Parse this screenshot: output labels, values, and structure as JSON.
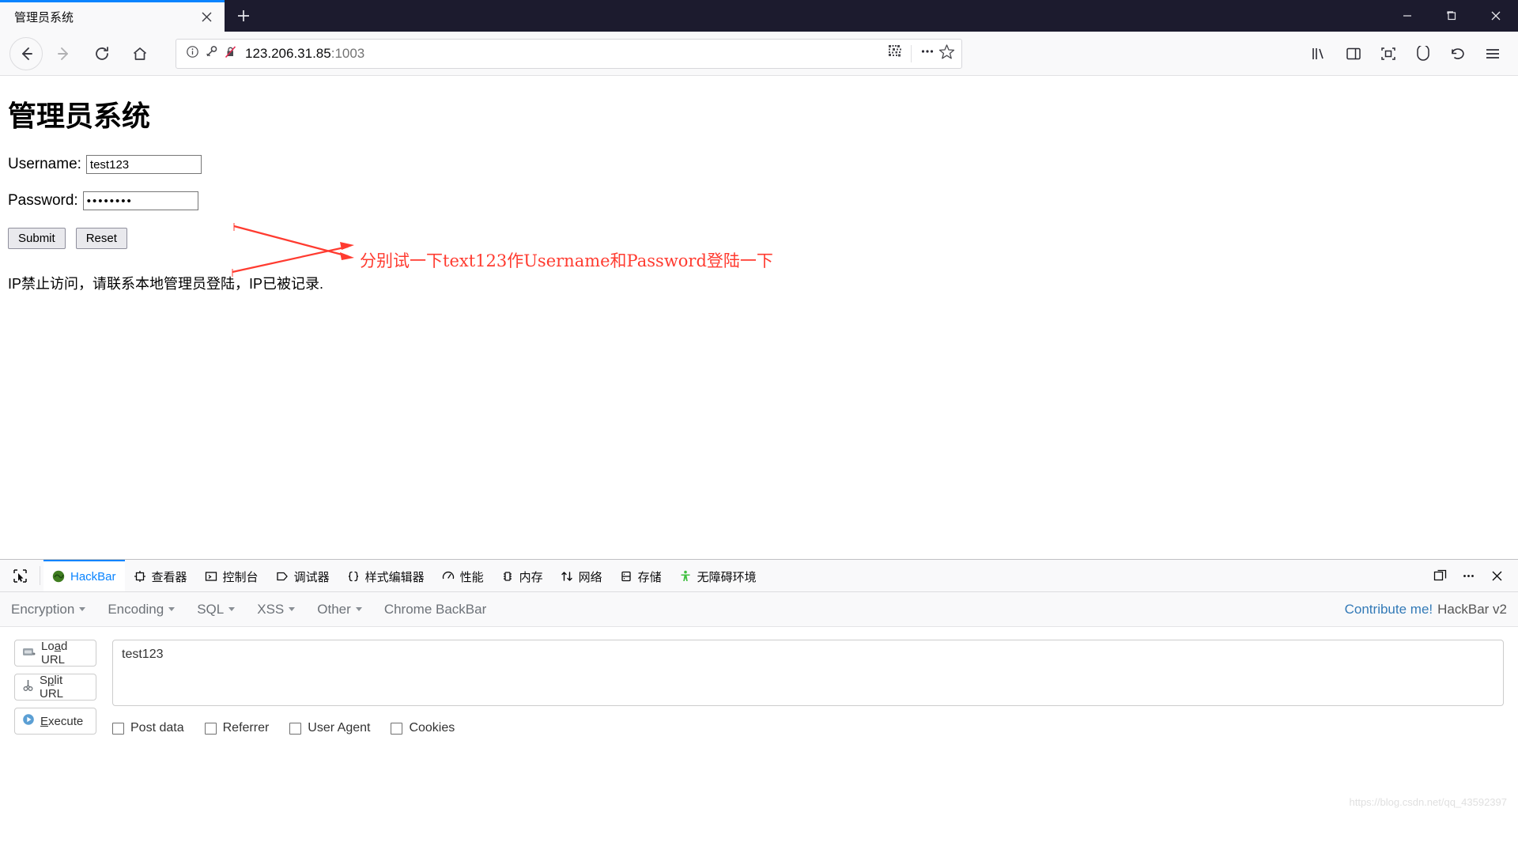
{
  "browser": {
    "tab": {
      "title": "管理员系统",
      "close_icon": "close-icon"
    },
    "newtab_label": "+",
    "window_controls": {
      "minimize": "–",
      "maximize": "▢",
      "close": "✕"
    },
    "nav": {
      "back": "back-arrow-icon",
      "forward": "forward-arrow-icon",
      "reload": "reload-icon",
      "home": "home-icon"
    },
    "url": {
      "host": "123.206.31.85",
      "port": ":1003",
      "identity_icon": "info-icon",
      "key_icon": "key-icon",
      "insecure_icon": "insecure-lock-icon",
      "qr_icon": "qr-code-icon",
      "more_icon": "page-actions-icon",
      "bookmark_icon": "star-icon"
    },
    "toolbar_icons": [
      "library-icon",
      "sidebar-icon",
      "screenshot-icon",
      "pocket-icon",
      "undo-icon",
      "menu-icon"
    ]
  },
  "page": {
    "heading": "管理员系统",
    "username_label": "Username:",
    "username_value": "test123",
    "password_label": "Password:",
    "password_value": "••••••••",
    "submit_label": "Submit",
    "reset_label": "Reset",
    "notice": "IP禁止访问，请联系本地管理员登陆，IP已被记录."
  },
  "annotation": {
    "text": "分别试一下text123作Username和Password登陆一下",
    "color": "#ff3b30"
  },
  "devtools": {
    "picker_icon": "element-picker-icon",
    "tabs": [
      {
        "label": "HackBar",
        "icon": "hackbar-icon",
        "active": true
      },
      {
        "label": "查看器",
        "icon": "inspector-icon",
        "active": false
      },
      {
        "label": "控制台",
        "icon": "console-icon",
        "active": false
      },
      {
        "label": "调试器",
        "icon": "debugger-icon",
        "active": false
      },
      {
        "label": "样式编辑器",
        "icon": "style-editor-icon",
        "active": false
      },
      {
        "label": "性能",
        "icon": "performance-icon",
        "active": false
      },
      {
        "label": "内存",
        "icon": "memory-icon",
        "active": false
      },
      {
        "label": "网络",
        "icon": "network-icon",
        "active": false
      },
      {
        "label": "存储",
        "icon": "storage-icon",
        "active": false
      },
      {
        "label": "无障碍环境",
        "icon": "accessibility-icon",
        "active": false
      }
    ],
    "right_controls": [
      "dock-icon",
      "meatball-menu-icon",
      "close-icon"
    ]
  },
  "hackbar": {
    "menus": [
      {
        "label": "Encryption",
        "has_caret": true
      },
      {
        "label": "Encoding",
        "has_caret": true
      },
      {
        "label": "SQL",
        "has_caret": true
      },
      {
        "label": "XSS",
        "has_caret": true
      },
      {
        "label": "Other",
        "has_caret": true
      },
      {
        "label": "Chrome BackBar",
        "has_caret": false
      }
    ],
    "contribute_label": "Contribute me!",
    "version_label": "HackBar v2",
    "buttons": [
      {
        "label": "Load URL",
        "icon": "load-url-icon"
      },
      {
        "label": "Split URL",
        "icon": "split-url-icon"
      },
      {
        "label": "Execute",
        "icon": "execute-icon"
      }
    ],
    "textarea_value": "test123",
    "checkboxes": [
      {
        "label": "Post data",
        "checked": false
      },
      {
        "label": "Referrer",
        "checked": false
      },
      {
        "label": "User Agent",
        "checked": false
      },
      {
        "label": "Cookies",
        "checked": false
      }
    ]
  },
  "watermark": "https://blog.csdn.net/qq_43592397"
}
